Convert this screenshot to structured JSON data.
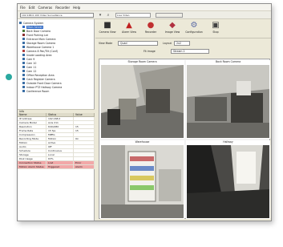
{
  "menu": {
    "items": [
      "File",
      "Edit",
      "Cameras",
      "Recorder",
      "Help"
    ]
  },
  "toolbar": {
    "address": "192.168.0.100 Video Surveillance",
    "view_field": "Live Video",
    "refresh_field": ""
  },
  "tree": {
    "items": [
      {
        "label": "Camera System",
        "color": "#3a6ea5",
        "selected": false
      },
      {
        "label": "Main Server",
        "color": "#316ac5",
        "selected": true
      },
      {
        "label": "Back Door Camera",
        "color": "#4a7a3a",
        "selected": false
      },
      {
        "label": "Front Parking Lot",
        "color": "#8a3030",
        "selected": false
      },
      {
        "label": "Entrance Main Camera",
        "color": "#3a6ea5",
        "selected": false
      },
      {
        "label": "Storage Room Camera",
        "color": "#3a6ea5",
        "selected": false
      },
      {
        "label": "Warehouse Camera 1",
        "color": "#3a6ea5",
        "selected": false
      },
      {
        "label": "Camera 8 Pan/Tilt (Conf)",
        "color": "#b04040",
        "selected": false
      },
      {
        "label": "Inside Loading Area",
        "color": "#3a6ea5",
        "selected": false
      },
      {
        "label": "Cam 9",
        "color": "#3a6ea5",
        "selected": false
      },
      {
        "label": "Cam 10",
        "color": "#3a6ea5",
        "selected": false
      },
      {
        "label": "Cam 11",
        "color": "#3a6ea5",
        "selected": false
      },
      {
        "label": "Cam 12",
        "color": "#3a6ea5",
        "selected": false
      },
      {
        "label": "Office Reception Area",
        "color": "#3a6ea5",
        "selected": false
      },
      {
        "label": "Cash Register Camera",
        "color": "#3a6ea5",
        "selected": false
      },
      {
        "label": "Outside Front Door Camera",
        "color": "#3a6ea5",
        "selected": false
      },
      {
        "label": "Indoor PTZ Hallway Camera",
        "color": "#3a6ea5",
        "selected": false
      },
      {
        "label": "Conference Room",
        "color": "#3a6ea5",
        "selected": false
      }
    ]
  },
  "properties": {
    "title": "Info",
    "headers": [
      "Name",
      "Status",
      "Value"
    ],
    "rows": [
      {
        "cells": [
          "IP Address",
          "192.168.0",
          ""
        ],
        "alert": false
      },
      {
        "cells": [
          "Camera Model",
          "Axis 211",
          ""
        ],
        "alert": false
      },
      {
        "cells": [
          "Resolution",
          "640x480",
          "15"
        ],
        "alert": false
      },
      {
        "cells": [
          "Frame Rate",
          "15 fps",
          "15"
        ],
        "alert": false
      },
      {
        "cells": [
          "Compression",
          "MPEG",
          ""
        ],
        "alert": false
      },
      {
        "cells": [
          "Recording Mode",
          "Motion",
          "On"
        ],
        "alert": false
      },
      {
        "cells": [
          "Motion",
          "Active",
          ""
        ],
        "alert": false
      },
      {
        "cells": [
          "Audio",
          "Off",
          ""
        ],
        "alert": false
      },
      {
        "cells": [
          "Schedule",
          "Continuous",
          ""
        ],
        "alert": false
      },
      {
        "cells": [
          "Storage",
          "Local",
          ""
        ],
        "alert": false
      },
      {
        "cells": [
          "Disk Usage",
          "63%",
          ""
        ],
        "alert": false
      },
      {
        "cells": [
          "Connection Status",
          "Lost",
          "Error"
        ],
        "alert": true
      },
      {
        "cells": [
          "Motion Alarm Status",
          "Triggered",
          "Alarm"
        ],
        "alert": true
      }
    ]
  },
  "actions": [
    {
      "label": "Camera View",
      "icon": "camera-icon",
      "glyph": "■",
      "color": "#303030"
    },
    {
      "label": "Alarm View",
      "icon": "alert-icon",
      "glyph": "▲",
      "color": "#c02020"
    },
    {
      "label": "Recorder",
      "icon": "record-icon",
      "glyph": "●",
      "color": "#c03030"
    },
    {
      "label": "Image View",
      "icon": "image-icon",
      "glyph": "◆",
      "color": "#b03040"
    },
    {
      "label": "Configuration",
      "icon": "config-icon",
      "glyph": "⚙",
      "color": "#5a6aa5"
    },
    {
      "label": "Stop",
      "icon": "stop-icon",
      "glyph": "▣",
      "color": "#404040"
    }
  ],
  "options": {
    "view_label": "View Mode",
    "view_value": "Quad",
    "layout_label": "Layout",
    "layout_value": "2x2",
    "check_label": "Fit image",
    "select_label": "Stream 2"
  },
  "cameras": [
    {
      "title": "Storage Room Camera"
    },
    {
      "title": "Back Room Camera"
    },
    {
      "title": "Warehouse"
    },
    {
      "title": "Hallway"
    }
  ]
}
